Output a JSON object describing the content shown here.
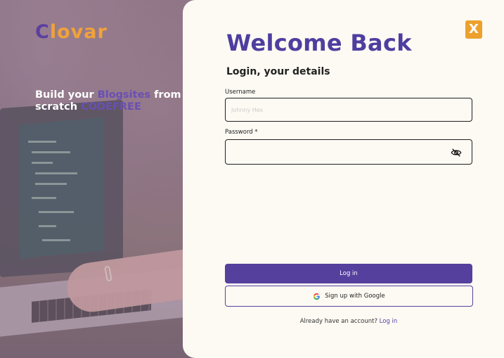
{
  "brand": {
    "logo_first": "C",
    "logo_rest": "lovar",
    "accent": "#55409e",
    "highlight": "#f0a23a"
  },
  "hero": {
    "tagline_part1": "Build your ",
    "tagline_highlight1": "Blogsites",
    "tagline_part2": " from scratch ",
    "tagline_highlight2": "CODEFREE"
  },
  "dialog": {
    "close_label": "X",
    "title": "Welcome Back",
    "subtitle": "Login, your details"
  },
  "form": {
    "username_label": "Username",
    "username_placeholder": "Johnny Hex",
    "username_value": "",
    "password_label": "Password *",
    "password_value": "",
    "password_toggle_icon": "eye-off-icon"
  },
  "actions": {
    "login_label": "Log in",
    "google_label": "Sign up with Google",
    "google_icon": "google-icon"
  },
  "footer": {
    "prompt": "Already have an account? ",
    "link_label": "Log in"
  }
}
